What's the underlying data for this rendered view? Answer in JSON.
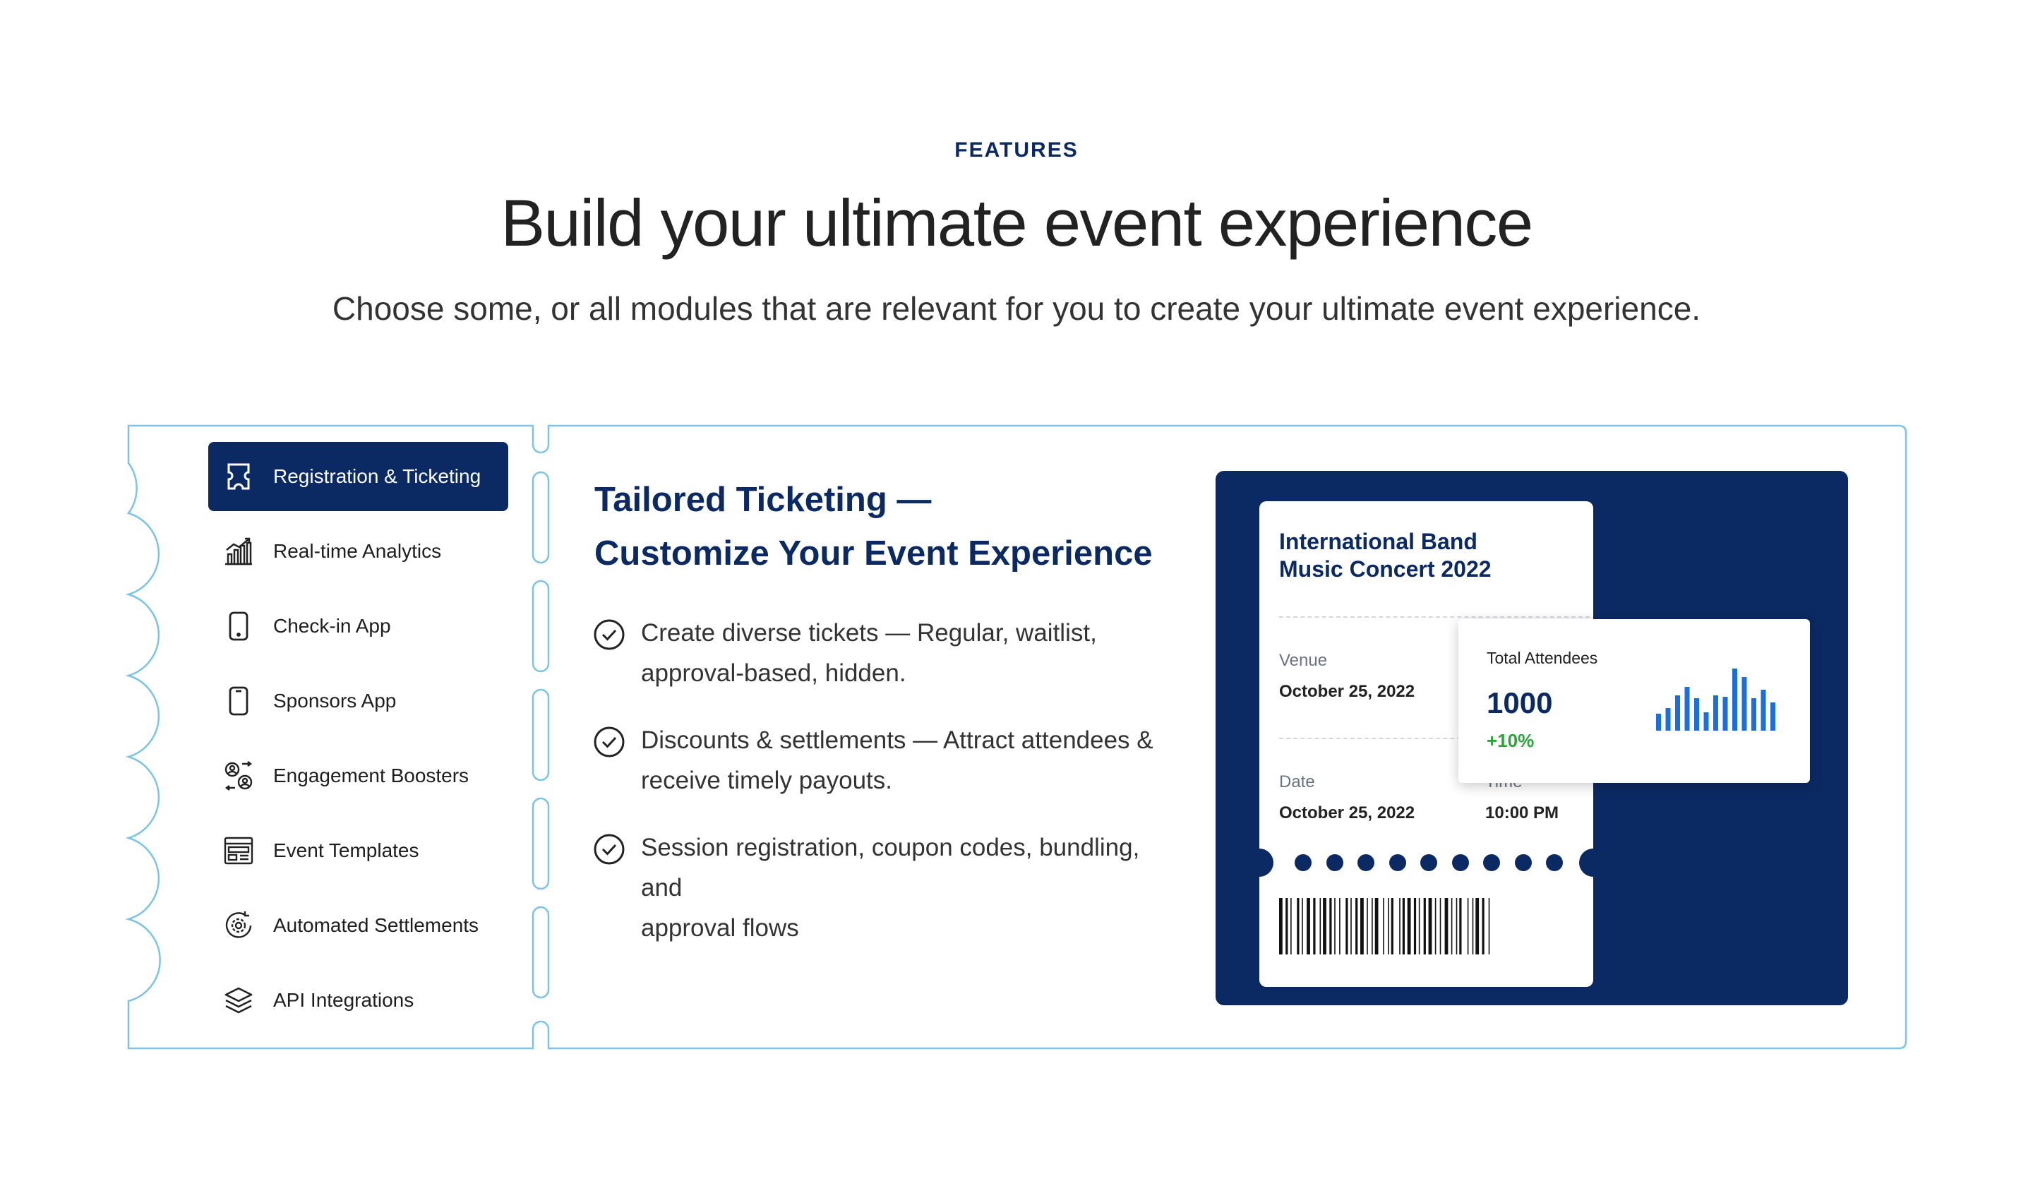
{
  "section": {
    "eyebrow": "FEATURES",
    "title": "Build your ultimate event experience",
    "subtitle": "Choose some, or all modules that are relevant for you to create your ultimate event experience."
  },
  "sidebar": {
    "items": [
      {
        "label": "Registration & Ticketing",
        "icon": "ticket-icon",
        "active": true
      },
      {
        "label": "Real-time Analytics",
        "icon": "analytics-chart-icon",
        "active": false
      },
      {
        "label": "Check-in App",
        "icon": "mobile-phone-icon",
        "active": false
      },
      {
        "label": "Sponsors App",
        "icon": "mobile-phone-icon",
        "active": false
      },
      {
        "label": "Engagement Boosters",
        "icon": "engagement-people-icon",
        "active": false
      },
      {
        "label": "Event Templates",
        "icon": "template-layout-icon",
        "active": false
      },
      {
        "label": "Automated Settlements",
        "icon": "settlement-gear-icon",
        "active": false
      },
      {
        "label": "API Integrations",
        "icon": "layers-icon",
        "active": false
      }
    ]
  },
  "content": {
    "title_line1": "Tailored Ticketing —",
    "title_line2": "Customize Your Event Experience",
    "bullets": [
      {
        "line1": "Create diverse tickets — Regular, waitlist,",
        "line2": "approval-based, hidden."
      },
      {
        "line1": "Discounts & settlements — Attract attendees &",
        "line2": "receive timely payouts."
      },
      {
        "line1": "Session registration, coupon codes, bundling, and",
        "line2": "approval flows"
      }
    ]
  },
  "ticket": {
    "title_line1": "International Band",
    "title_line2": "Music Concert 2022",
    "venue_label": "Venue",
    "venue_value": "October 25, 2022",
    "date_label": "Date",
    "date_value": "October 25, 2022",
    "time_label": "Time",
    "time_value": "10:00 PM"
  },
  "stats": {
    "label": "Total Attendees",
    "value": "1000",
    "delta": "+10%"
  },
  "colors": {
    "navy": "#0b2a63",
    "frame": "#7cc3e6",
    "bar": "#1a6fe0",
    "positive": "#2aa33a"
  }
}
